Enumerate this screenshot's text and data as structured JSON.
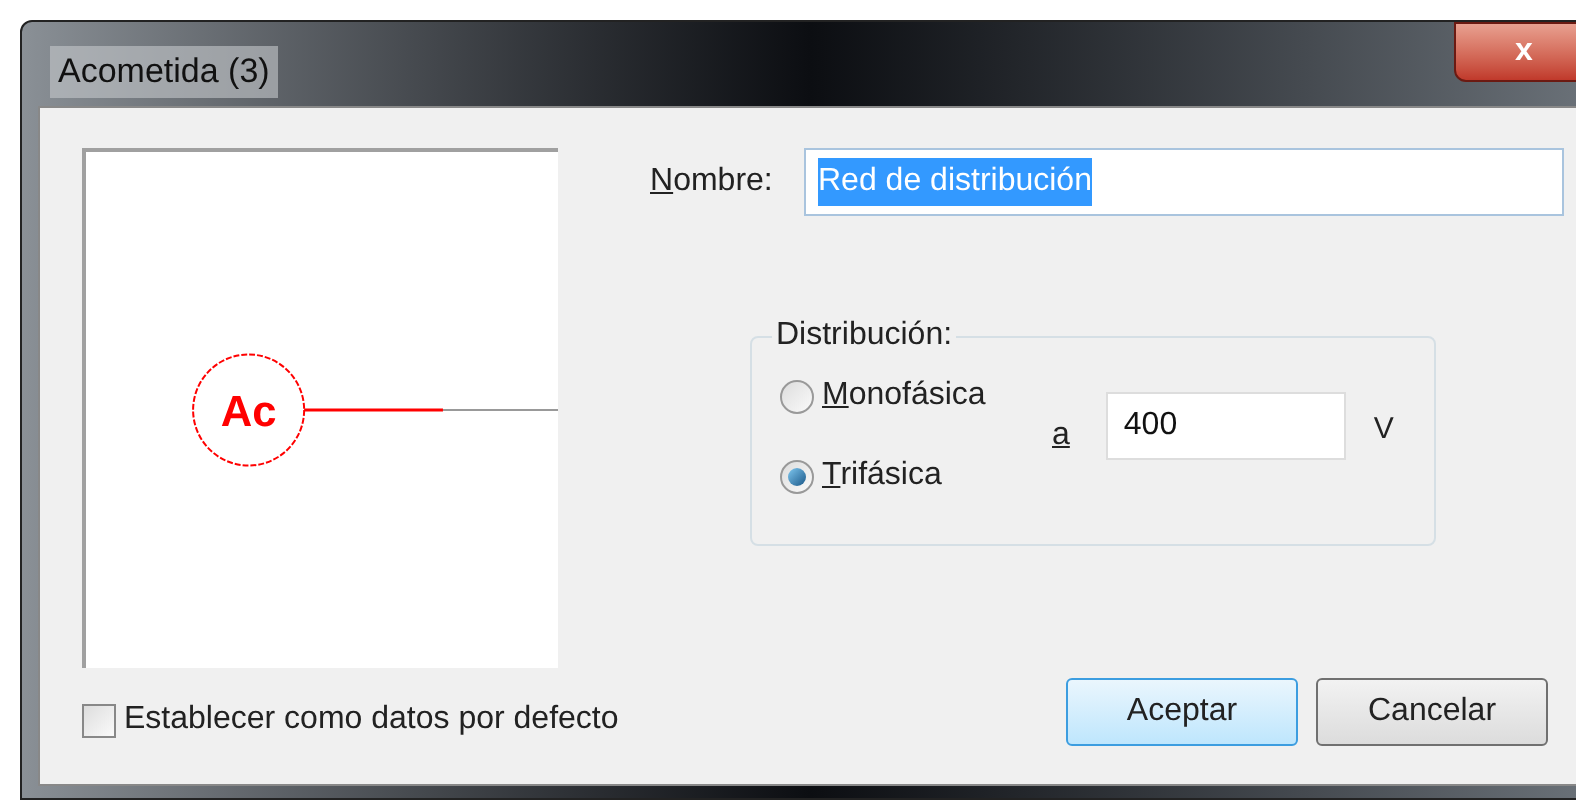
{
  "window": {
    "title": "Acometida (3)",
    "close": "x"
  },
  "preview": {
    "symbol": "Ac"
  },
  "name_field": {
    "label": "Nombre:",
    "value": "Red de distribución",
    "text_selected": true
  },
  "distribution": {
    "legend": "Distribución:",
    "options": [
      {
        "label": "Monofásica",
        "selected": false
      },
      {
        "label": "Trifásica",
        "selected": true
      }
    ],
    "voltage_label": "a",
    "voltage": "400",
    "unit": "V"
  },
  "default_checkbox": {
    "label": "Establecer como datos por defecto",
    "checked": false
  },
  "buttons": [
    {
      "label": "Aceptar",
      "default": true
    },
    {
      "label": "Cancelar",
      "default": false
    }
  ]
}
